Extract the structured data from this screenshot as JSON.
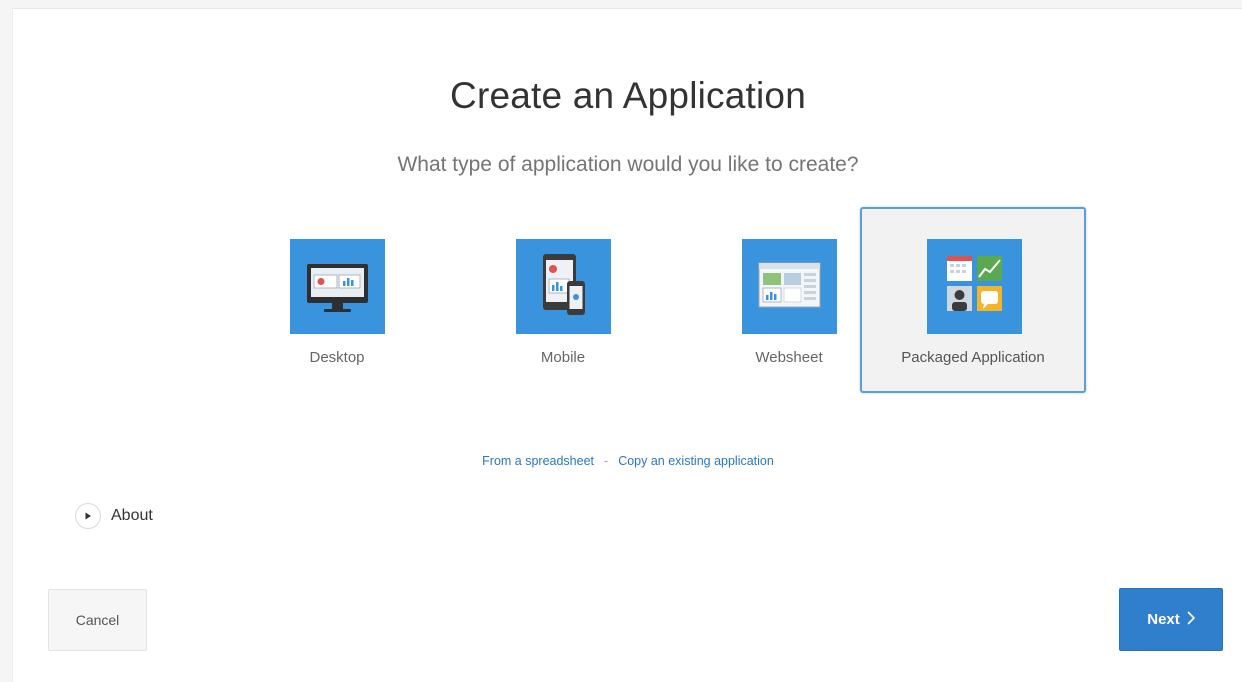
{
  "dialog": {
    "title": "Create an Application",
    "subtitle": "What type of application would you like to create?"
  },
  "app_types": [
    {
      "label": "Desktop",
      "icon": "desktop-monitor-icon",
      "selected": false
    },
    {
      "label": "Mobile",
      "icon": "mobile-devices-icon",
      "selected": false
    },
    {
      "label": "Websheet",
      "icon": "websheet-icon",
      "selected": false
    },
    {
      "label": "Packaged Application",
      "icon": "packaged-app-grid-icon",
      "selected": true
    }
  ],
  "links": {
    "spreadsheet": "From a spreadsheet",
    "separator": "-",
    "copy": "Copy an existing application"
  },
  "about": {
    "label": "About",
    "icon": "play-triangle-icon"
  },
  "buttons": {
    "cancel": "Cancel",
    "next": "Next",
    "next_icon": "chevron-right-icon"
  },
  "colors": {
    "icon_bg": "#3a93dd",
    "selected_border": "#5c9fd6",
    "link": "#2a78c2",
    "primary_button": "#2f7fcc"
  }
}
